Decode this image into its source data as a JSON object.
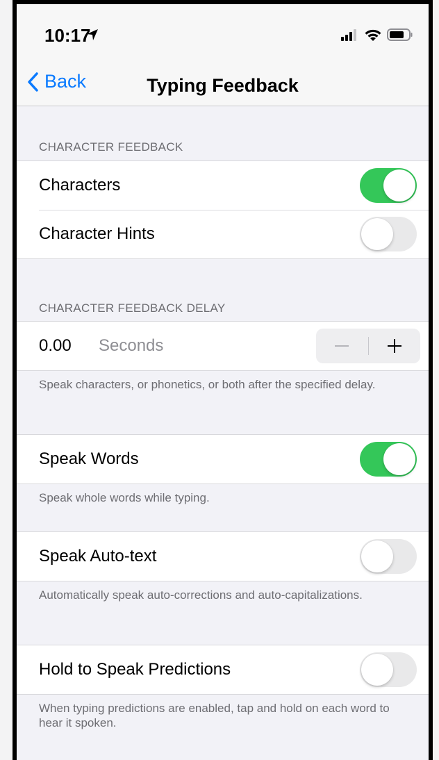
{
  "status_bar": {
    "time": "10:17",
    "icons": [
      "location-arrow-icon",
      "signal-icon",
      "wifi-icon",
      "battery-icon"
    ]
  },
  "nav": {
    "back_label": "Back",
    "title": "Typing Feedback"
  },
  "sections": {
    "character_feedback": {
      "header": "CHARACTER FEEDBACK",
      "rows": [
        {
          "label": "Characters",
          "on": true
        },
        {
          "label": "Character Hints",
          "on": false
        }
      ]
    },
    "delay": {
      "header": "CHARACTER FEEDBACK DELAY",
      "value": "0.00",
      "unit": "Seconds",
      "footer": "Speak characters, or phonetics, or both after the specified delay."
    },
    "speak_words": {
      "label": "Speak Words",
      "on": true,
      "footer": "Speak whole words while typing."
    },
    "speak_auto_text": {
      "label": "Speak Auto-text",
      "on": false,
      "footer": "Automatically speak auto-corrections and auto-capitalizations."
    },
    "hold_to_speak": {
      "label": "Hold to Speak Predictions",
      "on": false,
      "footer": "When typing predictions are enabled, tap and hold on each word to hear it spoken."
    }
  },
  "colors": {
    "accent": "#0a7aff",
    "toggle_on": "#34c759",
    "toggle_off": "#e9e9ea",
    "background": "#f2f2f7",
    "secondary_text": "#6d6d72"
  }
}
